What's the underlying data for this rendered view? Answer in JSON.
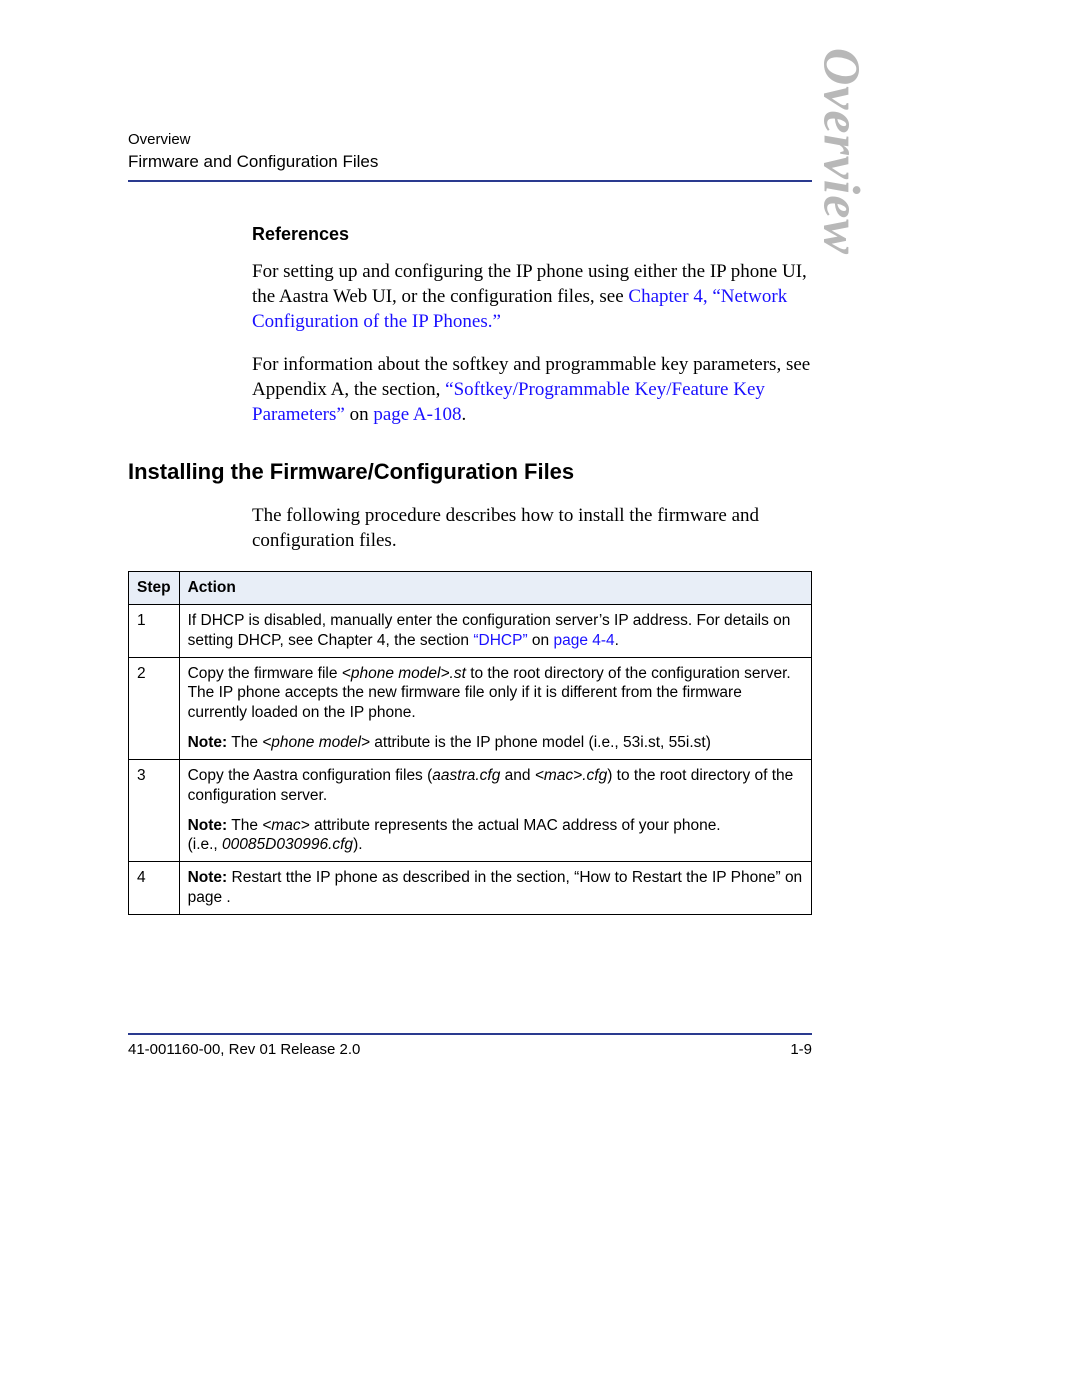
{
  "header": {
    "breadcrumb": "Overview",
    "section": "Firmware and Configuration Files"
  },
  "watermark": "Overview",
  "references": {
    "heading": "References",
    "p1_a": "For setting up and configuring the IP phone using either the IP phone UI, the Aastra Web UI, or the configuration files, see ",
    "p1_link": "Chapter 4, “Network Configuration of the IP Phones.”",
    "p2_a": "For information about the softkey and programmable key parameters, see Appendix A, the section, ",
    "p2_link1": "“Softkey/Programmable Key/Feature Key Parameters”",
    "p2_mid": " on ",
    "p2_link2": "page A-108",
    "p2_end": "."
  },
  "install": {
    "heading": "Installing the Firmware/Configuration Files",
    "intro": "The following procedure describes how to install the firmware and configuration files."
  },
  "table": {
    "col_step": "Step",
    "col_action": "Action",
    "rows": [
      {
        "num": "1",
        "t1a": "If DHCP is disabled, manually enter the configuration server’s IP address. For details on setting DHCP, see Chapter 4, the section ",
        "t1link1": "“DHCP”",
        "t1mid": " on ",
        "t1link2": "page 4-4",
        "t1end": "."
      },
      {
        "num": "2",
        "t1a": "Copy the firmware file ",
        "t1i": "<phone model>.st",
        "t1b": " to the root directory of the configuration server. The IP phone accepts the new firmware file only if it is different from the firmware currently loaded on the IP phone.",
        "note_label": "Note:",
        "note_a": " The ",
        "note_i": "<phone model>",
        "note_b": " attribute is the IP phone model (i.e., 53i.st, 55i.st)"
      },
      {
        "num": "3",
        "t1a": "Copy the Aastra configuration files (",
        "t1i1": "aastra.cfg",
        "t1mid1": " and ",
        "t1i2": "<mac>.cfg",
        "t1b": ") to the root directory of the configuration server.",
        "note_label": "Note:",
        "note_a": " The ",
        "note_i": "<mac>",
        "note_b": " attribute represents the actual MAC address of your phone.",
        "note_c_pre": "(i.e., ",
        "note_c_i": "00085D030996.cfg",
        "note_c_post": ")."
      },
      {
        "num": "4",
        "note_label": "Note:",
        "t1a": " Restart tthe IP phone as described in the section, “How to Restart the IP Phone” on page ."
      }
    ]
  },
  "footer": {
    "left": "41-001160-00, Rev 01  Release 2.0",
    "right": "1-9"
  }
}
